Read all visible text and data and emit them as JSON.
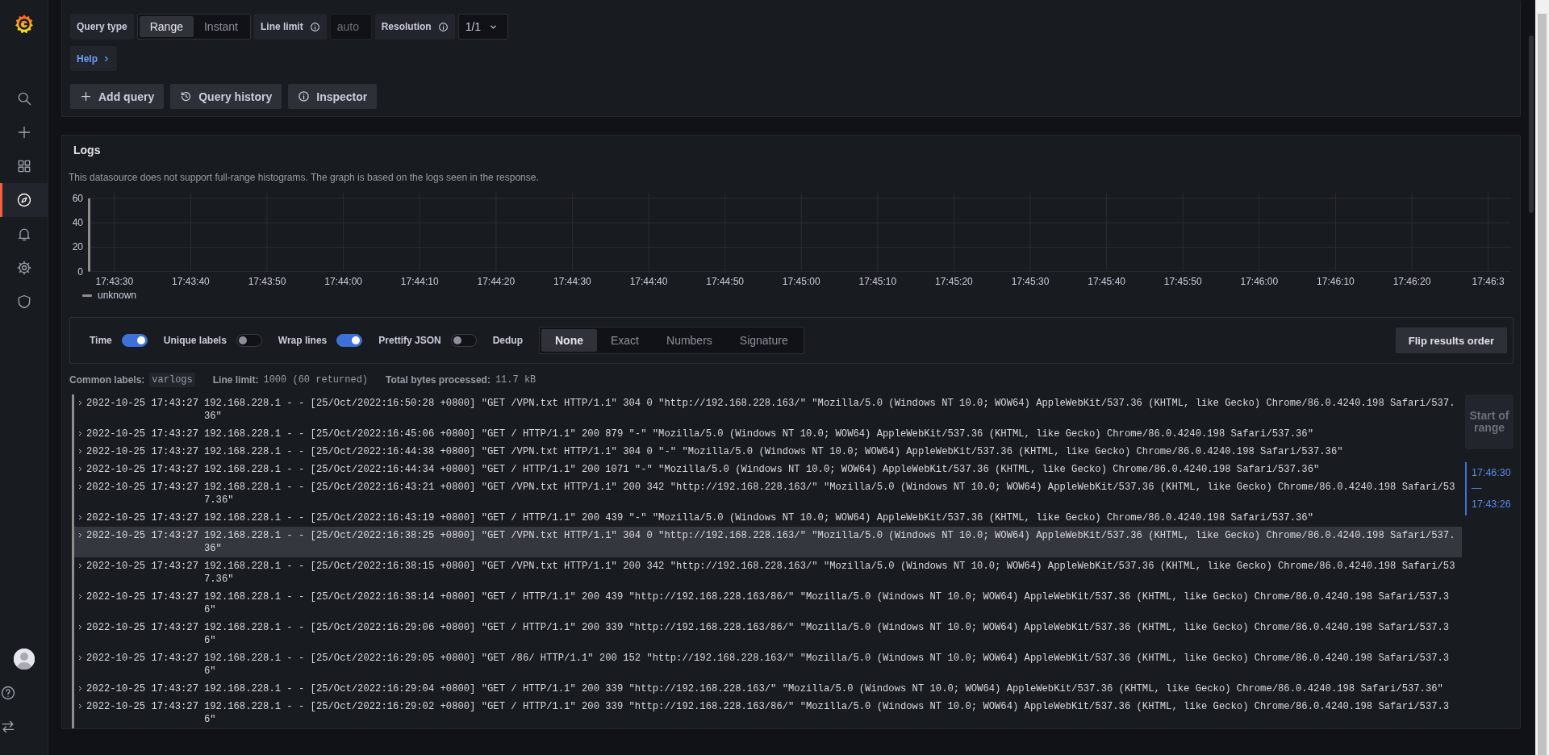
{
  "sidebar": {
    "items": [
      {
        "kind": "search",
        "selected": false
      },
      {
        "kind": "plus",
        "selected": false
      },
      {
        "kind": "grid",
        "selected": false
      },
      {
        "kind": "compass",
        "selected": true
      },
      {
        "kind": "bell",
        "selected": false
      },
      {
        "kind": "gear",
        "selected": false
      },
      {
        "kind": "shield",
        "selected": false
      }
    ],
    "bottom_items": [
      {
        "kind": "avatar"
      },
      {
        "kind": "help"
      },
      {
        "kind": "swap"
      }
    ]
  },
  "query": {
    "query_type": {
      "label": "Query type",
      "options": [
        {
          "label": "Range",
          "selected": true
        },
        {
          "label": "Instant",
          "selected": false
        }
      ]
    },
    "line_limit": {
      "label": "Line limit",
      "placeholder": "auto"
    },
    "resolution": {
      "label": "Resolution",
      "value": "1/1"
    },
    "help": "Help",
    "buttons": [
      {
        "label": "Add query",
        "kind": "plus"
      },
      {
        "label": "Query history",
        "kind": "history"
      },
      {
        "label": "Inspector",
        "kind": "info"
      }
    ]
  },
  "logs": {
    "title": "Logs",
    "notice": "This datasource does not support full-range histograms. The graph is based on the logs seen in the response.",
    "chart_data": {
      "type": "bar",
      "categories": [
        "17:43:30",
        "17:43:40",
        "17:43:50",
        "17:44:00",
        "17:44:10",
        "17:44:20",
        "17:44:30",
        "17:44:40",
        "17:44:50",
        "17:45:00",
        "17:45:10",
        "17:45:20",
        "17:45:30",
        "17:45:40",
        "17:45:50",
        "17:46:00",
        "17:46:10",
        "17:46:20",
        "17:46:3"
      ],
      "series": [
        {
          "name": "unknown",
          "color": "#8e8e8e",
          "values": [
            60,
            null,
            null,
            null,
            null,
            null,
            null,
            null,
            null,
            null,
            null,
            null,
            null,
            null,
            null,
            null,
            null,
            null,
            null
          ]
        }
      ],
      "ylim": [
        0,
        60
      ],
      "yticks": [
        0,
        20,
        40,
        60
      ],
      "grid": true
    },
    "toggles": [
      {
        "label": "Time",
        "on": true
      },
      {
        "label": "Unique labels",
        "on": false
      },
      {
        "label": "Wrap lines",
        "on": true
      },
      {
        "label": "Prettify JSON",
        "on": false
      }
    ],
    "dedup": {
      "label": "Dedup",
      "options": [
        {
          "label": "None",
          "selected": true
        },
        {
          "label": "Exact",
          "selected": false
        },
        {
          "label": "Numbers",
          "selected": false
        },
        {
          "label": "Signature",
          "selected": false
        }
      ]
    },
    "flip_button": "Flip results order",
    "meta": [
      {
        "label": "Common labels:",
        "value": "varlogs",
        "kind": "tag"
      },
      {
        "label": "Line limit:",
        "value": "1000 (60 returned)",
        "kind": "plain"
      },
      {
        "label": "Total bytes processed:",
        "value": "11.7 kB",
        "kind": "plain"
      }
    ],
    "rows": [
      {
        "time": "2022-10-25 17:43:27",
        "message": "192.168.228.1 - - [25/Oct/2022:16:50:28 +0800] \"GET /VPN.txt HTTP/1.1\" 304 0 \"http://192.168.228.163/\" \"Mozilla/5.0 (Windows NT 10.0; WOW64) AppleWebKit/537.36 (KHTML, like Gecko) Chrome/86.0.4240.198 Safari/537.36\"",
        "hovered": false
      },
      {
        "time": "2022-10-25 17:43:27",
        "message": "192.168.228.1 - - [25/Oct/2022:16:45:06 +0800] \"GET / HTTP/1.1\" 200 879 \"-\" \"Mozilla/5.0 (Windows NT 10.0; WOW64) AppleWebKit/537.36 (KHTML, like Gecko) Chrome/86.0.4240.198 Safari/537.36\"",
        "hovered": false
      },
      {
        "time": "2022-10-25 17:43:27",
        "message": "192.168.228.1 - - [25/Oct/2022:16:44:38 +0800] \"GET /VPN.txt HTTP/1.1\" 304 0 \"-\" \"Mozilla/5.0 (Windows NT 10.0; WOW64) AppleWebKit/537.36 (KHTML, like Gecko) Chrome/86.0.4240.198 Safari/537.36\"",
        "hovered": false
      },
      {
        "time": "2022-10-25 17:43:27",
        "message": "192.168.228.1 - - [25/Oct/2022:16:44:34 +0800] \"GET / HTTP/1.1\" 200 1071 \"-\" \"Mozilla/5.0 (Windows NT 10.0; WOW64) AppleWebKit/537.36 (KHTML, like Gecko) Chrome/86.0.4240.198 Safari/537.36\"",
        "hovered": false
      },
      {
        "time": "2022-10-25 17:43:27",
        "message": "192.168.228.1 - - [25/Oct/2022:16:43:21 +0800] \"GET /VPN.txt HTTP/1.1\" 200 342 \"http://192.168.228.163/\" \"Mozilla/5.0 (Windows NT 10.0; WOW64) AppleWebKit/537.36 (KHTML, like Gecko) Chrome/86.0.4240.198 Safari/537.36\"",
        "hovered": false
      },
      {
        "time": "2022-10-25 17:43:27",
        "message": "192.168.228.1 - - [25/Oct/2022:16:43:19 +0800] \"GET / HTTP/1.1\" 200 439 \"-\" \"Mozilla/5.0 (Windows NT 10.0; WOW64) AppleWebKit/537.36 (KHTML, like Gecko) Chrome/86.0.4240.198 Safari/537.36\"",
        "hovered": false
      },
      {
        "time": "2022-10-25 17:43:27",
        "message": "192.168.228.1 - - [25/Oct/2022:16:38:25 +0800] \"GET /VPN.txt HTTP/1.1\" 304 0 \"http://192.168.228.163/\" \"Mozilla/5.0 (Windows NT 10.0; WOW64) AppleWebKit/537.36 (KHTML, like Gecko) Chrome/86.0.4240.198 Safari/537.36\"",
        "hovered": true
      },
      {
        "time": "2022-10-25 17:43:27",
        "message": "192.168.228.1 - - [25/Oct/2022:16:38:15 +0800] \"GET /VPN.txt HTTP/1.1\" 200 342 \"http://192.168.228.163/\" \"Mozilla/5.0 (Windows NT 10.0; WOW64) AppleWebKit/537.36 (KHTML, like Gecko) Chrome/86.0.4240.198 Safari/537.36\"",
        "hovered": false
      },
      {
        "time": "2022-10-25 17:43:27",
        "message": "192.168.228.1 - - [25/Oct/2022:16:38:14 +0800] \"GET / HTTP/1.1\" 200 439 \"http://192.168.228.163/86/\" \"Mozilla/5.0 (Windows NT 10.0; WOW64) AppleWebKit/537.36 (KHTML, like Gecko) Chrome/86.0.4240.198 Safari/537.36\"",
        "hovered": false
      },
      {
        "time": "2022-10-25 17:43:27",
        "message": "192.168.228.1 - - [25/Oct/2022:16:29:06 +0800] \"GET / HTTP/1.1\" 200 339 \"http://192.168.228.163/86/\" \"Mozilla/5.0 (Windows NT 10.0; WOW64) AppleWebKit/537.36 (KHTML, like Gecko) Chrome/86.0.4240.198 Safari/537.36\"",
        "hovered": false
      },
      {
        "time": "2022-10-25 17:43:27",
        "message": "192.168.228.1 - - [25/Oct/2022:16:29:05 +0800] \"GET /86/ HTTP/1.1\" 200 152 \"http://192.168.228.163/\" \"Mozilla/5.0 (Windows NT 10.0; WOW64) AppleWebKit/537.36 (KHTML, like Gecko) Chrome/86.0.4240.198 Safari/537.36\"",
        "hovered": false
      },
      {
        "time": "2022-10-25 17:43:27",
        "message": "192.168.228.1 - - [25/Oct/2022:16:29:04 +0800] \"GET / HTTP/1.1\" 200 339 \"http://192.168.228.163/\" \"Mozilla/5.0 (Windows NT 10.0; WOW64) AppleWebKit/537.36 (KHTML, like Gecko) Chrome/86.0.4240.198 Safari/537.36\"",
        "hovered": false
      },
      {
        "time": "2022-10-25 17:43:27",
        "message": "192.168.228.1 - - [25/Oct/2022:16:29:02 +0800] \"GET / HTTP/1.1\" 200 339 \"http://192.168.228.163/86/\" \"Mozilla/5.0 (Windows NT 10.0; WOW64) AppleWebKit/537.36 (KHTML, like Gecko) Chrome/86.0.4240.198 Safari/537.36\"",
        "hovered": false
      }
    ],
    "range": {
      "start": "Start of range",
      "span": "17:46:30 — 17:43:26"
    }
  }
}
